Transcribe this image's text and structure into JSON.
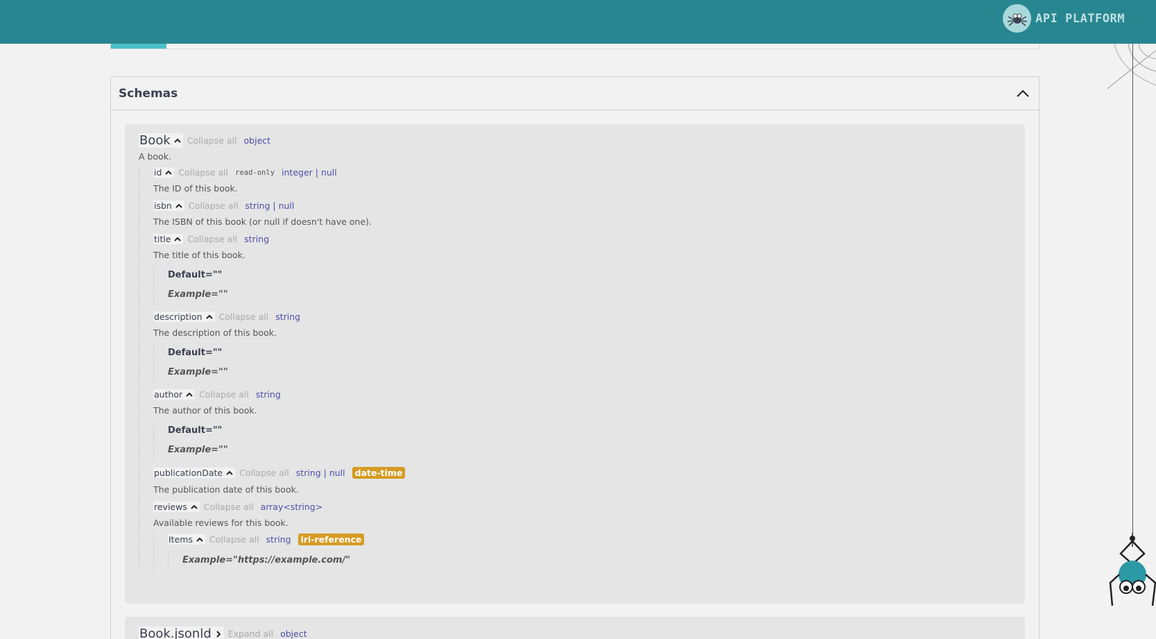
{
  "header": {
    "brand": "API PLATFORM"
  },
  "schemas": {
    "title": "Schemas",
    "book": {
      "name": "Book",
      "collapse_label": "Collapse all",
      "type": "object",
      "description": "A book.",
      "props": [
        {
          "name": "id",
          "collapse": "Collapse all",
          "readonly": "read-only",
          "type": "integer | null",
          "desc": "The ID of this book."
        },
        {
          "name": "isbn",
          "collapse": "Collapse all",
          "type": "string | null",
          "desc": "The ISBN of this book (or null if doesn't have one)."
        },
        {
          "name": "title",
          "collapse": "Collapse all",
          "type": "string",
          "desc": "The title of this book.",
          "default": "Default=\"\"",
          "example": "Example=\"\""
        },
        {
          "name": "description",
          "collapse": "Collapse all",
          "type": "string",
          "desc": "The description of this book.",
          "default": "Default=\"\"",
          "example": "Example=\"\""
        },
        {
          "name": "author",
          "collapse": "Collapse all",
          "type": "string",
          "desc": "The author of this book.",
          "default": "Default=\"\"",
          "example": "Example=\"\""
        },
        {
          "name": "publicationDate",
          "collapse": "Collapse all",
          "type": "string | null",
          "format": "date-time",
          "desc": "The publication date of this book."
        },
        {
          "name": "reviews",
          "collapse": "Collapse all",
          "type": "array<string>",
          "desc": "Available reviews for this book.",
          "items": {
            "name": "Items",
            "collapse": "Collapse all",
            "type": "string",
            "format": "iri-reference",
            "example": "Example=\"https://example.com/\""
          }
        }
      ]
    },
    "book_jsonld": {
      "name": "Book.jsonld",
      "expand_label": "Expand all",
      "type": "object"
    }
  }
}
